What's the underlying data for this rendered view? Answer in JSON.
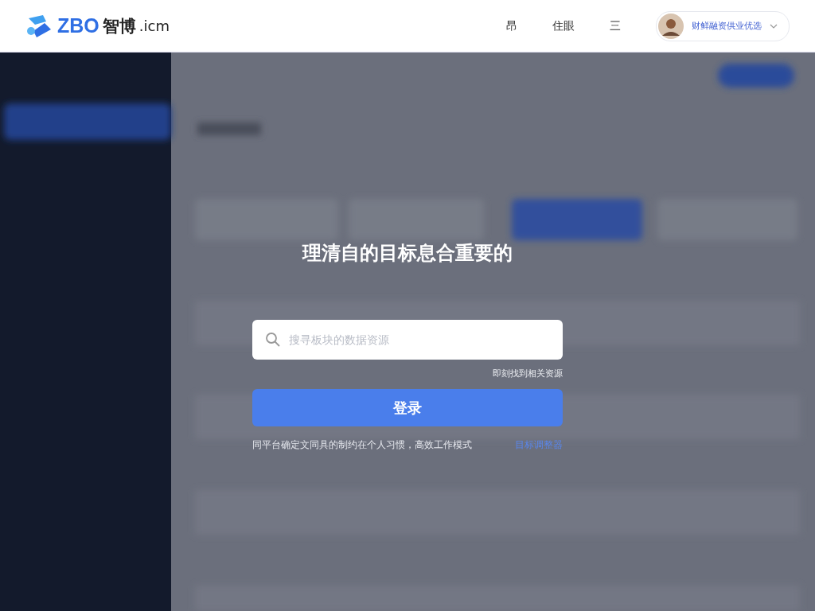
{
  "header": {
    "logo": {
      "brand": "ZBO",
      "name": "智博",
      "domain": ".icm"
    },
    "nav": [
      "昂",
      "住眼",
      "三"
    ],
    "user": {
      "name": "财鲜融资供业优选"
    }
  },
  "login": {
    "title": "理清自的目标息合重要的",
    "search": {
      "placeholder": "搜寻板块的数据资源"
    },
    "hint": "即刻找到相关资源",
    "submit": "登录",
    "footnote": "同平台确定文同具的制约在个人习惯，高效工作模式",
    "link": "目标调整器"
  }
}
